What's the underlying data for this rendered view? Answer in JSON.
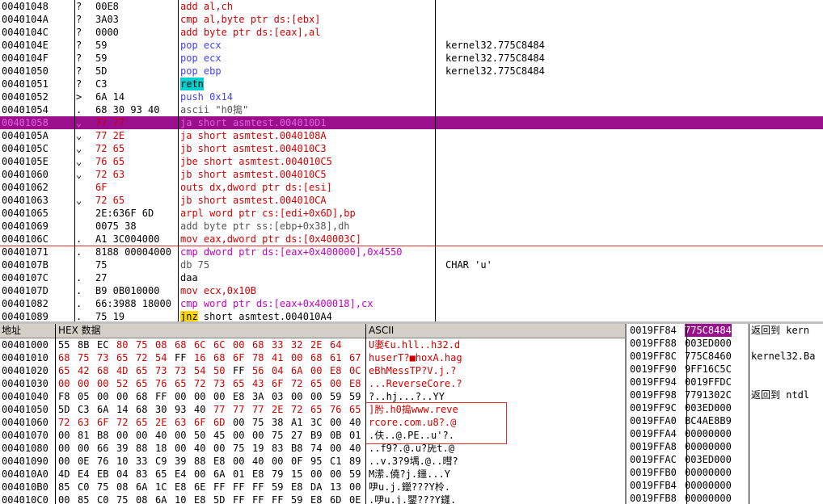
{
  "disasm": {
    "rows": [
      {
        "addr": "00401048",
        "mark": "?",
        "hex": "00E8",
        "ins": "add al,ch",
        "cmt": "",
        "style": "red"
      },
      {
        "addr": "0040104A",
        "mark": "?",
        "hex": "3A03",
        "ins": "cmp al,byte ptr ds:[ebx]",
        "cmt": "",
        "style": "red"
      },
      {
        "addr": "0040104C",
        "mark": "?",
        "hex": "0000",
        "ins": "add byte ptr ds:[eax],al",
        "cmt": "",
        "style": "red"
      },
      {
        "addr": "0040104E",
        "mark": "?",
        "hex": "59",
        "ins": "pop ecx",
        "cmt": "kernel32.775C8484",
        "style": "blu"
      },
      {
        "addr": "0040104F",
        "mark": "?",
        "hex": "59",
        "ins": "pop ecx",
        "cmt": "kernel32.775C8484",
        "style": "blu"
      },
      {
        "addr": "00401050",
        "mark": "?",
        "hex": "5D",
        "ins": "pop ebp",
        "cmt": "kernel32.775C8484",
        "style": "blu"
      },
      {
        "addr": "00401051",
        "mark": "?",
        "hex": "C3",
        "ins": "retn",
        "cmt": "",
        "style": "retn"
      },
      {
        "addr": "00401052",
        "mark": ">",
        "hex": "6A 14",
        "ins": "push 0x14",
        "cmt": "",
        "style": "blu"
      },
      {
        "addr": "00401054",
        "mark": ".",
        "hex": "68 30 93 40",
        "ins": "ascii \"h0搗\"",
        "cmt": "",
        "style": "gry"
      },
      {
        "addr": "00401058",
        "mark": "⌄",
        "hex": "77 77",
        "ins": "ja short asmtest.004010D1",
        "cmt": "",
        "style": "hl"
      },
      {
        "addr": "0040105A",
        "mark": "⌄",
        "hex": "77 2E",
        "ins": "ja short asmtest.0040108A",
        "cmt": "",
        "style": "red"
      },
      {
        "addr": "0040105C",
        "mark": "⌄",
        "hex": "72 65",
        "ins": "jb short asmtest.004010C3",
        "cmt": "",
        "style": "red"
      },
      {
        "addr": "0040105E",
        "mark": "⌄",
        "hex": "76 65",
        "ins": "jbe short asmtest.004010C5",
        "cmt": "",
        "style": "red"
      },
      {
        "addr": "00401060",
        "mark": "⌄",
        "hex": "72 63",
        "ins": "jb short asmtest.004010C5",
        "cmt": "",
        "style": "red"
      },
      {
        "addr": "00401062",
        "mark": "",
        "hex": "6F",
        "ins": "outs dx,dword ptr ds:[esi]",
        "cmt": "",
        "style": "red"
      },
      {
        "addr": "00401063",
        "mark": "⌄",
        "hex": "72 65",
        "ins": "jb short asmtest.004010CA",
        "cmt": "",
        "style": "red"
      },
      {
        "addr": "00401065",
        "mark": "",
        "hex": "2E:636F 6D",
        "ins": "arpl word ptr cs:[edi+0x6D],bp",
        "cmt": "",
        "style": "red"
      },
      {
        "addr": "00401069",
        "mark": "",
        "hex": "0075 38",
        "ins": "add byte ptr ss:[ebp+0x38],dh",
        "cmt": "",
        "style": "gry"
      },
      {
        "addr": "0040106C",
        "mark": ".",
        "hex": "A1 3C004000",
        "ins": "mov eax,dword ptr ds:[0x40003C]",
        "cmt": "",
        "style": "red"
      },
      {
        "addr": "00401071",
        "mark": ".",
        "hex": "8188 00004000",
        "ins": "cmp dword ptr ds:[eax+0x400000],0x4550",
        "cmt": "",
        "style": "mag"
      },
      {
        "addr": "0040107B",
        "mark": "",
        "hex": "75",
        "ins": "db 75",
        "cmt": "CHAR 'u'",
        "style": "gry"
      },
      {
        "addr": "0040107C",
        "mark": ".",
        "hex": "27",
        "ins": "daa",
        "cmt": "",
        "style": "plain"
      },
      {
        "addr": "0040107D",
        "mark": ".",
        "hex": "B9 0B010000",
        "ins": "mov ecx,0x10B",
        "cmt": "",
        "style": "red"
      },
      {
        "addr": "00401082",
        "mark": ".",
        "hex": "66:3988 18000",
        "ins": "cmp word ptr ds:[eax+0x400018],cx",
        "cmt": "",
        "style": "mag"
      },
      {
        "addr": "00401089",
        "mark": ".",
        "hex": "75 19",
        "ins": "jnz short asmtest.004010A4",
        "cmt": "",
        "style": "jnz"
      }
    ]
  },
  "dump": {
    "header": {
      "addr": "地址",
      "hex": "HEX 数据",
      "ascii": "ASCII"
    },
    "rows": [
      {
        "addr": "00401000",
        "bytes": [
          "55",
          "8B",
          "EC",
          "80",
          "75",
          "08",
          "68",
          "6C",
          "6C",
          "00",
          "68",
          "33",
          "32",
          "2E",
          "64"
        ],
        "red": [
          3,
          4,
          5,
          6,
          7,
          8,
          9,
          10,
          11,
          12,
          13,
          14
        ],
        "ascii": "U嬱€u.hll..h32.d"
      },
      {
        "addr": "00401010",
        "bytes": [
          "68",
          "75",
          "73",
          "65",
          "72",
          "54",
          "FF",
          "16",
          "68",
          "6F",
          "78",
          "41",
          "00",
          "68",
          "61",
          "67"
        ],
        "red": [
          0,
          1,
          2,
          3,
          4,
          5,
          7,
          8,
          9,
          10,
          11,
          12,
          13,
          14,
          15
        ],
        "ascii": "huserT?■hoxA.hag"
      },
      {
        "addr": "00401020",
        "bytes": [
          "65",
          "42",
          "68",
          "4D",
          "65",
          "73",
          "73",
          "54",
          "50",
          "FF",
          "56",
          "04",
          "6A",
          "00",
          "E8",
          "0C"
        ],
        "red": [
          0,
          1,
          2,
          3,
          4,
          5,
          6,
          7,
          8,
          10,
          11,
          12,
          13,
          14,
          15
        ],
        "ascii": "eBhMessTP?V.j.?"
      },
      {
        "addr": "00401030",
        "bytes": [
          "00",
          "00",
          "00",
          "52",
          "65",
          "76",
          "65",
          "72",
          "73",
          "65",
          "43",
          "6F",
          "72",
          "65",
          "00",
          "E8"
        ],
        "red": [
          0,
          1,
          2,
          3,
          4,
          5,
          6,
          7,
          8,
          9,
          10,
          11,
          12,
          13,
          14,
          15
        ],
        "ascii": "...ReverseCore.?"
      },
      {
        "addr": "00401040",
        "bytes": [
          "F8",
          "05",
          "00",
          "00",
          "68",
          "FF",
          "00",
          "00",
          "00",
          "E8",
          "3A",
          "03",
          "00",
          "00",
          "59",
          "59"
        ],
        "red": [],
        "ascii": "?..hj...?..YY"
      },
      {
        "addr": "00401050",
        "bytes": [
          "5D",
          "C3",
          "6A",
          "14",
          "68",
          "30",
          "93",
          "40",
          "77",
          "77",
          "77",
          "2E",
          "72",
          "65",
          "76",
          "65"
        ],
        "red": [
          8,
          9,
          10,
          11,
          12,
          13,
          14,
          15
        ],
        "ascii": "]肹.h0搗www.reve"
      },
      {
        "addr": "00401060",
        "bytes": [
          "72",
          "63",
          "6F",
          "72",
          "65",
          "2E",
          "63",
          "6F",
          "6D",
          "00",
          "75",
          "38",
          "A1",
          "3C",
          "00",
          "40"
        ],
        "red": [
          0,
          1,
          2,
          3,
          4,
          5,
          6,
          7,
          8
        ],
        "ascii": "rcore.com.u8?.@"
      },
      {
        "addr": "00401070",
        "bytes": [
          "00",
          "81",
          "B8",
          "00",
          "00",
          "40",
          "00",
          "50",
          "45",
          "00",
          "00",
          "75",
          "27",
          "B9",
          "0B",
          "01"
        ],
        "red": [],
        "ascii": ".伕..@.PE..u'?."
      },
      {
        "addr": "00401080",
        "bytes": [
          "00",
          "00",
          "66",
          "39",
          "88",
          "18",
          "00",
          "40",
          "00",
          "75",
          "19",
          "83",
          "B8",
          "74",
          "00",
          "40"
        ],
        "red": [],
        "ascii": "..f9?.@.u?兏t.@"
      },
      {
        "addr": "00401090",
        "bytes": [
          "00",
          "0E",
          "76",
          "10",
          "33",
          "C9",
          "39",
          "88",
          "E8",
          "00",
          "40",
          "00",
          "0F",
          "95",
          "C1",
          "89"
        ],
        "red": [],
        "ascii": "..v.3?9堣.@..暳?"
      },
      {
        "addr": "004010A0",
        "bytes": [
          "4D",
          "E4",
          "EB",
          "04",
          "83",
          "65",
          "E4",
          "00",
          "6A",
          "01",
          "E8",
          "79",
          "15",
          "00",
          "00",
          "59"
        ],
        "red": [],
        "ascii": "M潆.僥?j.鑩...Y"
      },
      {
        "addr": "004010B0",
        "bytes": [
          "85",
          "C0",
          "75",
          "08",
          "6A",
          "1C",
          "E8",
          "6E",
          "FF",
          "FF",
          "FF",
          "59",
          "E8",
          "DA",
          "13",
          "00"
        ],
        "red": [],
        "ascii": "吚u.j.鑞???Y柃."
      },
      {
        "addr": "004010C0",
        "bytes": [
          "00",
          "85",
          "C0",
          "75",
          "08",
          "6A",
          "10",
          "E8",
          "5D",
          "FF",
          "FF",
          "FF",
          "59",
          "E8",
          "6D",
          "0E"
        ],
        "red": [],
        "ascii": ".吚u.j.鑍???Y鑝."
      }
    ]
  },
  "stack": {
    "rows": [
      {
        "addr": "0019FF84",
        "val": "775C8484",
        "cmt": "返回到 kern",
        "sel": true
      },
      {
        "addr": "0019FF88",
        "val": "003ED000",
        "cmt": "",
        "sel": false
      },
      {
        "addr": "0019FF8C",
        "val": "775C8460",
        "cmt": "kernel32.Ba",
        "sel": false
      },
      {
        "addr": "0019FF90",
        "val": "9FF16C5C",
        "cmt": "",
        "sel": false
      },
      {
        "addr": "0019FF94",
        "val": "0019FFDC",
        "cmt": "",
        "sel": false
      },
      {
        "addr": "0019FF98",
        "val": "7791302C",
        "cmt": "返回到 ntdl",
        "sel": false
      },
      {
        "addr": "0019FF9C",
        "val": "003ED000",
        "cmt": "",
        "sel": false
      },
      {
        "addr": "0019FFA0",
        "val": "BC4AE8B9",
        "cmt": "",
        "sel": false
      },
      {
        "addr": "0019FFA4",
        "val": "00000000",
        "cmt": "",
        "sel": false
      },
      {
        "addr": "0019FFA8",
        "val": "00000000",
        "cmt": "",
        "sel": false
      },
      {
        "addr": "0019FFAC",
        "val": "003ED000",
        "cmt": "",
        "sel": false
      },
      {
        "addr": "0019FFB0",
        "val": "00000000",
        "cmt": "",
        "sel": false
      },
      {
        "addr": "0019FFB4",
        "val": "00000000",
        "cmt": "",
        "sel": false
      },
      {
        "addr": "0019FFB8",
        "val": "00000000",
        "cmt": "",
        "sel": false
      }
    ]
  },
  "colors": {
    "highlight": "#9c0f8c",
    "instruction_red": "#d00000",
    "instruction_magenta": "#c000c0",
    "register_blue": "#4040ff",
    "retn_bg": "#00d0d0",
    "jnz_bg": "#ffd700",
    "selection_box": "#e03030"
  }
}
